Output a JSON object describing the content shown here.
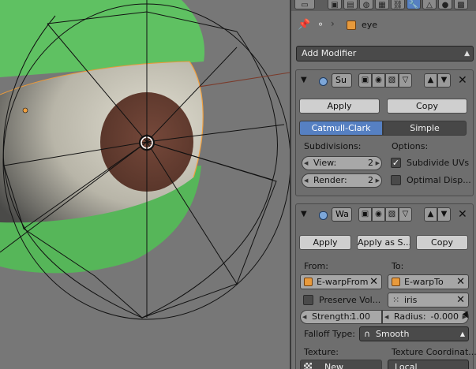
{
  "breadcrumb": {
    "object_name": "eye",
    "pin_icon": "pin-icon",
    "object_icon": "mesh-cube-icon"
  },
  "add_modifier": {
    "label": "Add Modifier"
  },
  "subsurf": {
    "name": "Su",
    "apply": "Apply",
    "copy": "Copy",
    "mode_catmull": "Catmull-Clark",
    "mode_simple": "Simple",
    "subdivisions_label": "Subdivisions:",
    "options_label": "Options:",
    "view_label": "View:",
    "view_value": "2",
    "render_label": "Render:",
    "render_value": "2",
    "subdivide_uvs": "Subdivide UVs",
    "subdivide_uvs_checked": true,
    "optimal_display": "Optimal Disp...",
    "optimal_display_checked": false
  },
  "warp": {
    "name": "Wa",
    "apply": "Apply",
    "apply_as_shape": "Apply as S...",
    "copy": "Copy",
    "from_label": "From:",
    "to_label": "To:",
    "from_value": "E-warpFrom",
    "to_value": "E-warpTo",
    "preserve_volume": "Preserve Vol...",
    "vertex_group": "iris",
    "strength_label": "Strength:",
    "strength_value": "1.00",
    "radius_label": "Radius:",
    "radius_value": "-0.000",
    "falloff_label": "Falloff Type:",
    "falloff_value": "Smooth",
    "texture_label": "Texture:",
    "texture_coords_label": "Texture Coordinat...",
    "new_label": "New",
    "local_label": "Local"
  },
  "colors": {
    "accent": "#5680c2",
    "viewport_bg": "#777777",
    "sclera_green": "#5fc162",
    "iris_brown": "#6b4235",
    "eyeball_white": "#d4d2c6"
  }
}
